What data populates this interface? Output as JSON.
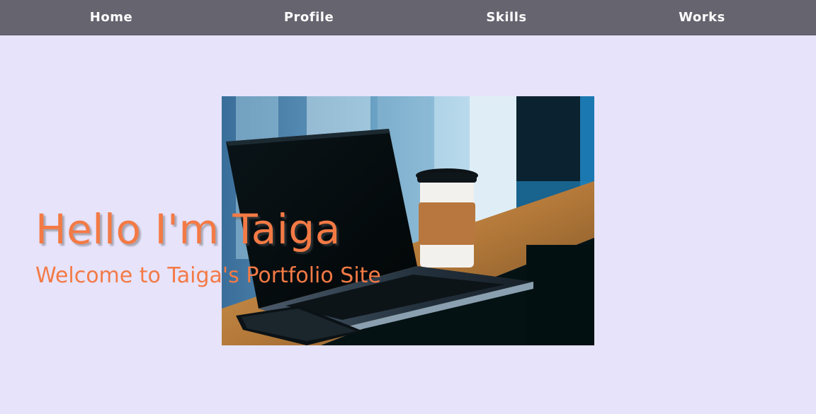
{
  "nav": {
    "items": [
      {
        "label": "Home"
      },
      {
        "label": "Profile"
      },
      {
        "label": "Skills"
      },
      {
        "label": "Works"
      }
    ]
  },
  "hero": {
    "title": "Hello I'm Taiga",
    "subtitle": "Welcome to Taiga's Portfolio Site"
  },
  "colors": {
    "background": "#e6e3fb",
    "navbar": "#66646f",
    "accent": "#f47a45"
  }
}
